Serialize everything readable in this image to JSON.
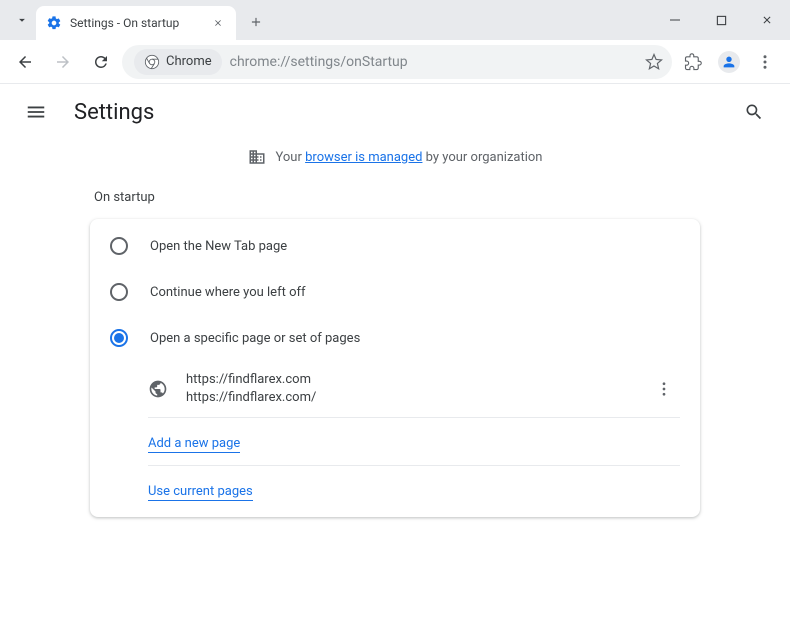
{
  "tab": {
    "title": "Settings - On startup"
  },
  "addressBar": {
    "chipLabel": "Chrome",
    "url": "chrome://settings/onStartup"
  },
  "header": {
    "title": "Settings"
  },
  "managed": {
    "prefix": "Your ",
    "link": "browser is managed",
    "suffix": " by your organization"
  },
  "section": {
    "title": "On startup"
  },
  "radios": {
    "opt1": "Open the New Tab page",
    "opt2": "Continue where you left off",
    "opt3": "Open a specific page or set of pages"
  },
  "startupPage": {
    "line1": "https://findflarex.com",
    "line2": "https://findflarex.com/"
  },
  "links": {
    "addPage": "Add a new page",
    "useCurrent": "Use current pages"
  }
}
